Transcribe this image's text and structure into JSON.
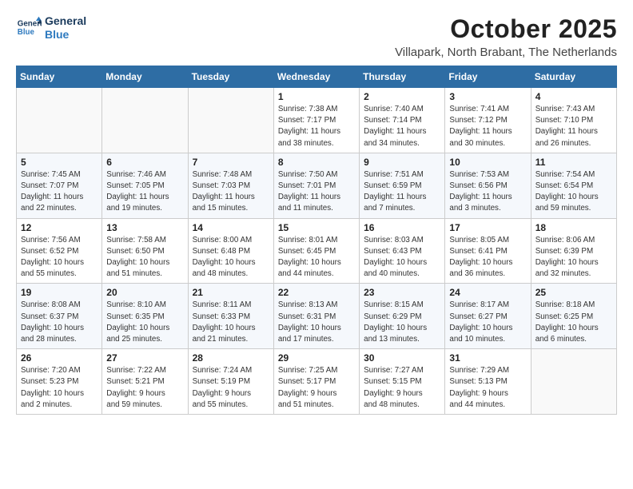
{
  "header": {
    "logo_line1": "General",
    "logo_line2": "Blue",
    "month": "October 2025",
    "location": "Villapark, North Brabant, The Netherlands"
  },
  "days_of_week": [
    "Sunday",
    "Monday",
    "Tuesday",
    "Wednesday",
    "Thursday",
    "Friday",
    "Saturday"
  ],
  "weeks": [
    [
      {
        "day": "",
        "info": ""
      },
      {
        "day": "",
        "info": ""
      },
      {
        "day": "",
        "info": ""
      },
      {
        "day": "1",
        "info": "Sunrise: 7:38 AM\nSunset: 7:17 PM\nDaylight: 11 hours\nand 38 minutes."
      },
      {
        "day": "2",
        "info": "Sunrise: 7:40 AM\nSunset: 7:14 PM\nDaylight: 11 hours\nand 34 minutes."
      },
      {
        "day": "3",
        "info": "Sunrise: 7:41 AM\nSunset: 7:12 PM\nDaylight: 11 hours\nand 30 minutes."
      },
      {
        "day": "4",
        "info": "Sunrise: 7:43 AM\nSunset: 7:10 PM\nDaylight: 11 hours\nand 26 minutes."
      }
    ],
    [
      {
        "day": "5",
        "info": "Sunrise: 7:45 AM\nSunset: 7:07 PM\nDaylight: 11 hours\nand 22 minutes."
      },
      {
        "day": "6",
        "info": "Sunrise: 7:46 AM\nSunset: 7:05 PM\nDaylight: 11 hours\nand 19 minutes."
      },
      {
        "day": "7",
        "info": "Sunrise: 7:48 AM\nSunset: 7:03 PM\nDaylight: 11 hours\nand 15 minutes."
      },
      {
        "day": "8",
        "info": "Sunrise: 7:50 AM\nSunset: 7:01 PM\nDaylight: 11 hours\nand 11 minutes."
      },
      {
        "day": "9",
        "info": "Sunrise: 7:51 AM\nSunset: 6:59 PM\nDaylight: 11 hours\nand 7 minutes."
      },
      {
        "day": "10",
        "info": "Sunrise: 7:53 AM\nSunset: 6:56 PM\nDaylight: 11 hours\nand 3 minutes."
      },
      {
        "day": "11",
        "info": "Sunrise: 7:54 AM\nSunset: 6:54 PM\nDaylight: 10 hours\nand 59 minutes."
      }
    ],
    [
      {
        "day": "12",
        "info": "Sunrise: 7:56 AM\nSunset: 6:52 PM\nDaylight: 10 hours\nand 55 minutes."
      },
      {
        "day": "13",
        "info": "Sunrise: 7:58 AM\nSunset: 6:50 PM\nDaylight: 10 hours\nand 51 minutes."
      },
      {
        "day": "14",
        "info": "Sunrise: 8:00 AM\nSunset: 6:48 PM\nDaylight: 10 hours\nand 48 minutes."
      },
      {
        "day": "15",
        "info": "Sunrise: 8:01 AM\nSunset: 6:45 PM\nDaylight: 10 hours\nand 44 minutes."
      },
      {
        "day": "16",
        "info": "Sunrise: 8:03 AM\nSunset: 6:43 PM\nDaylight: 10 hours\nand 40 minutes."
      },
      {
        "day": "17",
        "info": "Sunrise: 8:05 AM\nSunset: 6:41 PM\nDaylight: 10 hours\nand 36 minutes."
      },
      {
        "day": "18",
        "info": "Sunrise: 8:06 AM\nSunset: 6:39 PM\nDaylight: 10 hours\nand 32 minutes."
      }
    ],
    [
      {
        "day": "19",
        "info": "Sunrise: 8:08 AM\nSunset: 6:37 PM\nDaylight: 10 hours\nand 28 minutes."
      },
      {
        "day": "20",
        "info": "Sunrise: 8:10 AM\nSunset: 6:35 PM\nDaylight: 10 hours\nand 25 minutes."
      },
      {
        "day": "21",
        "info": "Sunrise: 8:11 AM\nSunset: 6:33 PM\nDaylight: 10 hours\nand 21 minutes."
      },
      {
        "day": "22",
        "info": "Sunrise: 8:13 AM\nSunset: 6:31 PM\nDaylight: 10 hours\nand 17 minutes."
      },
      {
        "day": "23",
        "info": "Sunrise: 8:15 AM\nSunset: 6:29 PM\nDaylight: 10 hours\nand 13 minutes."
      },
      {
        "day": "24",
        "info": "Sunrise: 8:17 AM\nSunset: 6:27 PM\nDaylight: 10 hours\nand 10 minutes."
      },
      {
        "day": "25",
        "info": "Sunrise: 8:18 AM\nSunset: 6:25 PM\nDaylight: 10 hours\nand 6 minutes."
      }
    ],
    [
      {
        "day": "26",
        "info": "Sunrise: 7:20 AM\nSunset: 5:23 PM\nDaylight: 10 hours\nand 2 minutes."
      },
      {
        "day": "27",
        "info": "Sunrise: 7:22 AM\nSunset: 5:21 PM\nDaylight: 9 hours\nand 59 minutes."
      },
      {
        "day": "28",
        "info": "Sunrise: 7:24 AM\nSunset: 5:19 PM\nDaylight: 9 hours\nand 55 minutes."
      },
      {
        "day": "29",
        "info": "Sunrise: 7:25 AM\nSunset: 5:17 PM\nDaylight: 9 hours\nand 51 minutes."
      },
      {
        "day": "30",
        "info": "Sunrise: 7:27 AM\nSunset: 5:15 PM\nDaylight: 9 hours\nand 48 minutes."
      },
      {
        "day": "31",
        "info": "Sunrise: 7:29 AM\nSunset: 5:13 PM\nDaylight: 9 hours\nand 44 minutes."
      },
      {
        "day": "",
        "info": ""
      }
    ]
  ]
}
